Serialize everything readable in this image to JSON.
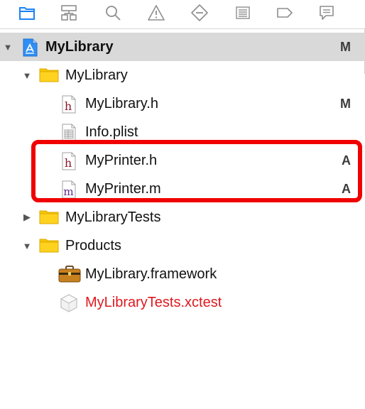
{
  "toolbar": {
    "icons": [
      {
        "name": "project-navigator-icon",
        "active": true
      },
      {
        "name": "symbol-navigator-icon"
      },
      {
        "name": "find-navigator-icon"
      },
      {
        "name": "issue-navigator-icon"
      },
      {
        "name": "test-navigator-icon"
      },
      {
        "name": "debug-navigator-icon"
      },
      {
        "name": "breakpoint-navigator-icon"
      },
      {
        "name": "report-navigator-icon"
      }
    ],
    "active_color": "#1a82f7",
    "icon_color": "#8e8e8e"
  },
  "tree": {
    "project": {
      "label": "MyLibrary",
      "badge": "M",
      "icon": "xcode-project-icon"
    },
    "group_mylibrary": {
      "label": "MyLibrary",
      "icon": "folder-icon"
    },
    "file_mylibrary_h": {
      "label": "MyLibrary.h",
      "badge": "M",
      "icon": "header-file-icon",
      "icon_glyph": "h"
    },
    "file_info_plist": {
      "label": "Info.plist",
      "icon": "plist-file-icon"
    },
    "file_myprinter_h": {
      "label": "MyPrinter.h",
      "badge": "A",
      "icon": "header-file-icon",
      "icon_glyph": "h"
    },
    "file_myprinter_m": {
      "label": "MyPrinter.m",
      "badge": "A",
      "icon": "objc-source-file-icon",
      "icon_glyph": "m"
    },
    "group_tests": {
      "label": "MyLibraryTests",
      "icon": "folder-icon"
    },
    "group_products": {
      "label": "Products",
      "icon": "folder-icon"
    },
    "product_framework": {
      "label": "MyLibrary.framework",
      "icon": "framework-icon"
    },
    "product_xctest": {
      "label": "MyLibraryTests.xctest",
      "icon": "xctest-bundle-icon",
      "missing": true
    }
  },
  "colors": {
    "folder": "#f7c500",
    "missing_text": "#e0181e",
    "highlight": "#f00000",
    "selected_row": "#d9d9d9"
  }
}
